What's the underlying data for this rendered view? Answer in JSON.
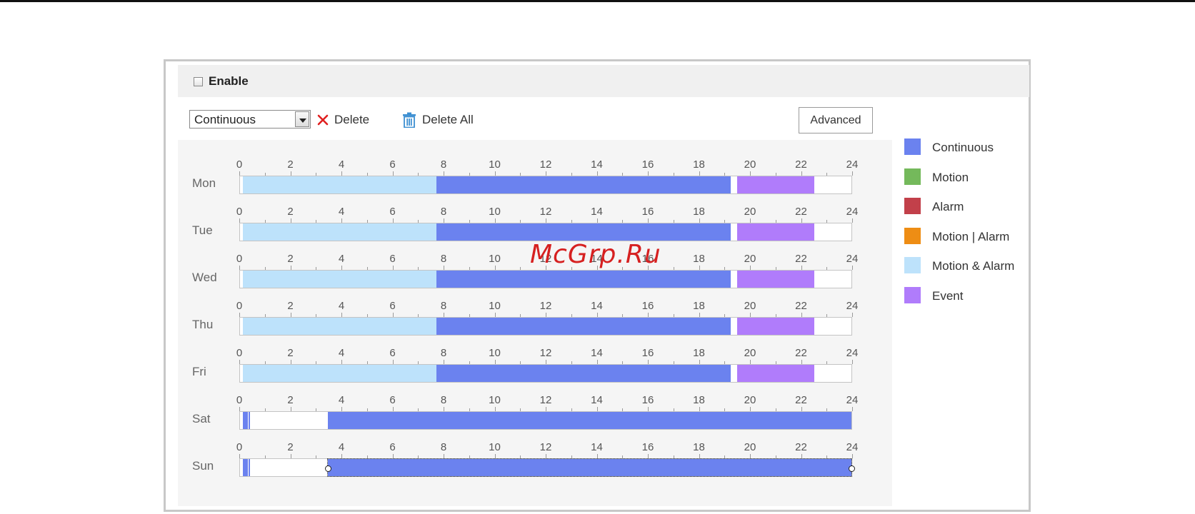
{
  "watermark": "McGrp.Ru",
  "enable": {
    "label": "Enable",
    "checked": false
  },
  "toolbar": {
    "type_select_value": "Continuous",
    "delete_label": "Delete",
    "delete_all_label": "Delete All",
    "advanced_label": "Advanced"
  },
  "hour_ticks": [
    "0",
    "2",
    "4",
    "6",
    "8",
    "10",
    "12",
    "14",
    "16",
    "18",
    "20",
    "22",
    "24"
  ],
  "legend": [
    {
      "name": "Continuous",
      "color": "#6b82ef"
    },
    {
      "name": "Motion",
      "color": "#74b95b"
    },
    {
      "name": "Alarm",
      "color": "#c2404a"
    },
    {
      "name": "Motion | Alarm",
      "color": "#ee8d14"
    },
    {
      "name": "Motion & Alarm",
      "color": "#bde2fb"
    },
    {
      "name": "Event",
      "color": "#b07cfb"
    }
  ],
  "days": [
    {
      "label": "Mon",
      "segments": [
        {
          "type": "Motion & Alarm",
          "start": 0.1,
          "end": 7.7
        },
        {
          "type": "Continuous",
          "start": 7.7,
          "end": 19.25
        },
        {
          "type": "Event",
          "start": 19.5,
          "end": 22.55
        }
      ]
    },
    {
      "label": "Tue",
      "segments": [
        {
          "type": "Motion & Alarm",
          "start": 0.1,
          "end": 7.7
        },
        {
          "type": "Continuous",
          "start": 7.7,
          "end": 19.25
        },
        {
          "type": "Event",
          "start": 19.5,
          "end": 22.55
        }
      ]
    },
    {
      "label": "Wed",
      "segments": [
        {
          "type": "Motion & Alarm",
          "start": 0.1,
          "end": 7.7
        },
        {
          "type": "Continuous",
          "start": 7.7,
          "end": 19.25
        },
        {
          "type": "Event",
          "start": 19.5,
          "end": 22.55
        }
      ]
    },
    {
      "label": "Thu",
      "segments": [
        {
          "type": "Motion & Alarm",
          "start": 0.1,
          "end": 7.7
        },
        {
          "type": "Continuous",
          "start": 7.7,
          "end": 19.25
        },
        {
          "type": "Event",
          "start": 19.5,
          "end": 22.55
        }
      ]
    },
    {
      "label": "Fri",
      "segments": [
        {
          "type": "Motion & Alarm",
          "start": 0.1,
          "end": 7.7
        },
        {
          "type": "Continuous",
          "start": 7.7,
          "end": 19.25
        },
        {
          "type": "Event",
          "start": 19.5,
          "end": 22.55
        }
      ]
    },
    {
      "label": "Sat",
      "segments": [
        {
          "type": "Continuous",
          "start": 0.1,
          "end": 0.3
        },
        {
          "type": "Continuous",
          "start": 0.35,
          "end": 0.38
        },
        {
          "type": "Continuous",
          "start": 3.45,
          "end": 24
        }
      ]
    },
    {
      "label": "Sun",
      "segments": [
        {
          "type": "Continuous",
          "start": 0.1,
          "end": 0.3
        },
        {
          "type": "Continuous",
          "start": 0.35,
          "end": 0.38
        },
        {
          "type": "Continuous",
          "start": 3.45,
          "end": 24,
          "selected": true
        }
      ]
    }
  ]
}
